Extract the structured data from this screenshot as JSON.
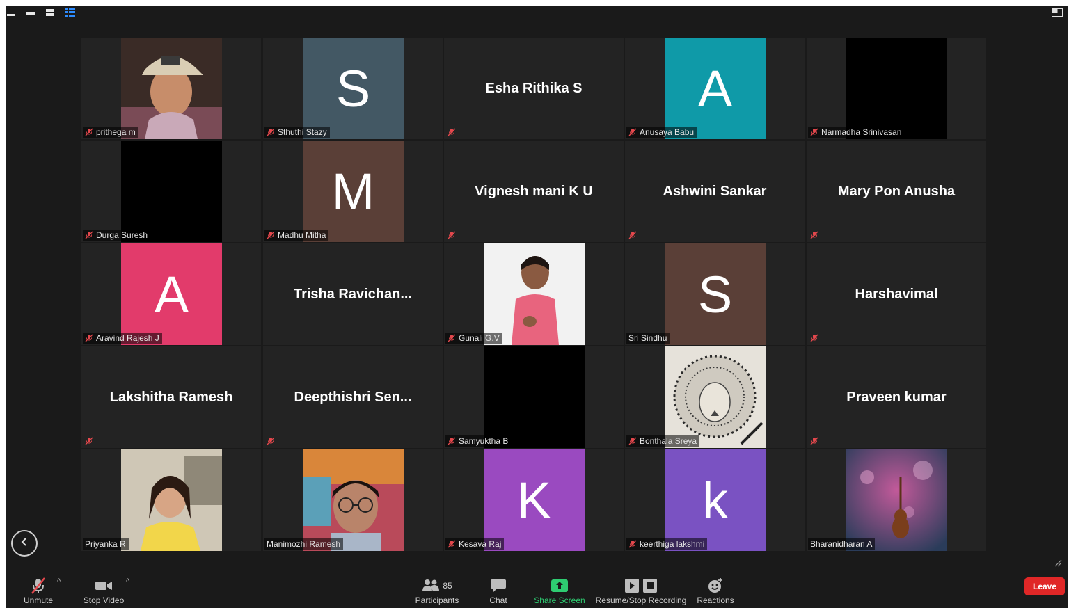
{
  "participants": [
    {
      "name": "prithega m",
      "display": "photo",
      "photo": "cap"
    },
    {
      "name": "Sthuthi Stazy",
      "display": "letter",
      "letter": "S",
      "color": "#435864"
    },
    {
      "name": "",
      "display": "name",
      "bigname": "Esha Rithika S"
    },
    {
      "name": "Anusaya Babu",
      "display": "letter",
      "letter": "A",
      "color": "#0f9aa8"
    },
    {
      "name": "Narmadha Srinivasan",
      "display": "black"
    },
    {
      "name": "Durga Suresh",
      "display": "black"
    },
    {
      "name": "Madhu Mitha",
      "display": "letter",
      "letter": "M",
      "color": "#5a3f37"
    },
    {
      "name": "",
      "display": "name",
      "bigname": "Vignesh mani K U"
    },
    {
      "name": "",
      "display": "name",
      "bigname": "Ashwini Sankar"
    },
    {
      "name": "",
      "display": "name",
      "bigname": "Mary Pon Anusha"
    },
    {
      "name": "Aravind Rajesh J",
      "display": "letter",
      "letter": "A",
      "color": "#e23b6b"
    },
    {
      "name": "",
      "display": "name",
      "bigname": "Trisha  Ravichan...",
      "hide_label": true
    },
    {
      "name": "Gunali G.V",
      "display": "photo",
      "photo": "pink"
    },
    {
      "name": "Sri Sindhu",
      "display": "letter",
      "letter": "S",
      "color": "#5a3f37",
      "no_mute": true
    },
    {
      "name": "",
      "display": "name",
      "bigname": "Harshavimal"
    },
    {
      "name": "",
      "display": "name",
      "bigname": "Lakshitha Ramesh"
    },
    {
      "name": "",
      "display": "name",
      "bigname": "Deepthishri  Sen..."
    },
    {
      "name": "Samyuktha B",
      "display": "black"
    },
    {
      "name": "Bonthala Sreya",
      "display": "photo",
      "photo": "lion"
    },
    {
      "name": "",
      "display": "name",
      "bigname": "Praveen kumar"
    },
    {
      "name": "Priyanka R",
      "display": "photo",
      "photo": "car",
      "no_mute": true
    },
    {
      "name": "Manimozhi Ramesh",
      "display": "photo",
      "photo": "glasses",
      "no_mute": true
    },
    {
      "name": "Kesava Raj",
      "display": "letter",
      "letter": "K",
      "color": "#9a4ac0"
    },
    {
      "name": "keerthiga lakshmi",
      "display": "letter",
      "letter": "k",
      "color": "#7a52c2"
    },
    {
      "name": "Bharanidharan A",
      "display": "photo",
      "photo": "violin",
      "no_mute": true
    }
  ],
  "toolbar": {
    "unmute_label": "Unmute",
    "stop_video_label": "Stop Video",
    "participants_label": "Participants",
    "participants_count": "85",
    "chat_label": "Chat",
    "share_label": "Share Screen",
    "recording_label": "Resume/Stop Recording",
    "reactions_label": "Reactions",
    "leave_label": "Leave"
  },
  "colors": {
    "share": "#2ecc71",
    "leave": "#e02727",
    "muted": "#e5484d",
    "view_active": "#2d8cff"
  },
  "icons": [
    "minimize-icon",
    "restore-icon",
    "view-bars-icon",
    "gallery-grid-icon",
    "exit-fullscreen-icon",
    "mic-muted-icon",
    "camera-icon",
    "participants-icon",
    "chat-icon",
    "share-screen-icon",
    "recording-icon",
    "reactions-icon",
    "back-arrow-icon"
  ]
}
